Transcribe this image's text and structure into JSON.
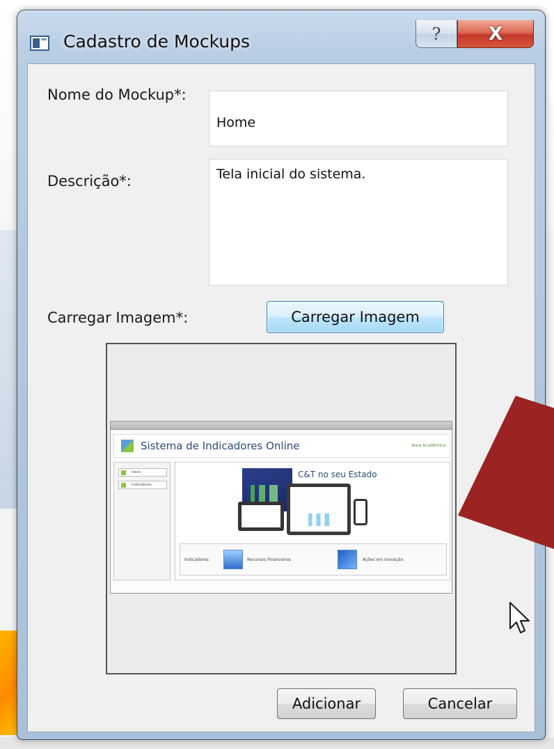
{
  "window": {
    "title": "Cadastro de Mockups",
    "help_label": "?",
    "close_label": "X"
  },
  "form": {
    "name_label": "Nome do Mockup*:",
    "name_value": "Home",
    "description_label": "Descrição*:",
    "description_value": "Tela inicial do sistema.",
    "image_label": "Carregar Imagem*:",
    "load_button_label": "Carregar Imagem"
  },
  "preview": {
    "title": "Sistema de Indicadores Online",
    "top_link": "Área Acadêmica",
    "hero_title": "C&T no seu Estado",
    "sidebar_items": [
      "Início",
      "Indicadores"
    ],
    "footer_label": "Indicadores:",
    "footer_items": [
      "Recursos Financeiros",
      "Ações em Inovação"
    ]
  },
  "actions": {
    "add_label": "Adicionar",
    "cancel_label": "Cancelar"
  },
  "colors": {
    "arrow": "#9b2422",
    "load_button_border": "#3c7fb1",
    "close_button": "#c4392a"
  }
}
